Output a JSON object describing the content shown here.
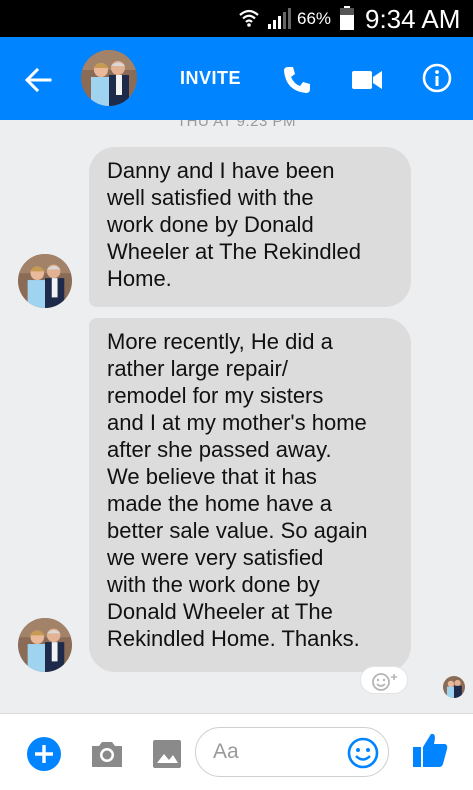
{
  "status_bar": {
    "battery_percent": "66%",
    "time": "9:34 AM",
    "icons": [
      "wifi-icon",
      "signal-icon",
      "battery-icon"
    ]
  },
  "header": {
    "invite_label": "INVITE",
    "background_color": "#0084ff",
    "icons": [
      "back-arrow-icon",
      "phone-icon",
      "video-camera-icon",
      "info-icon"
    ]
  },
  "chat": {
    "timestamp": "THU AT 9:23 PM",
    "messages": [
      {
        "text": "Danny and I have been\nwell satisfied with the\nwork done by Donald\nWheeler at The Rekindled\nHome."
      },
      {
        "text": "More recently, He did a\nrather large repair/\nremodel for my sisters\nand I at my mother's home\nafter she passed away.\nWe believe that it has\nmade the home have a\nbetter sale value. So again\nwe were very satisfied\nwith the work done by\nDonald Wheeler at The\nRekindled Home.  Thanks."
      }
    ],
    "bubble_color": "#dcdcdc",
    "background_color": "#edeef0"
  },
  "composer": {
    "placeholder": "Aa",
    "accent_color": "#0084ff",
    "icons": [
      "add-icon",
      "camera-icon",
      "gallery-icon",
      "emoji-icon",
      "thumbs-up-icon"
    ]
  }
}
